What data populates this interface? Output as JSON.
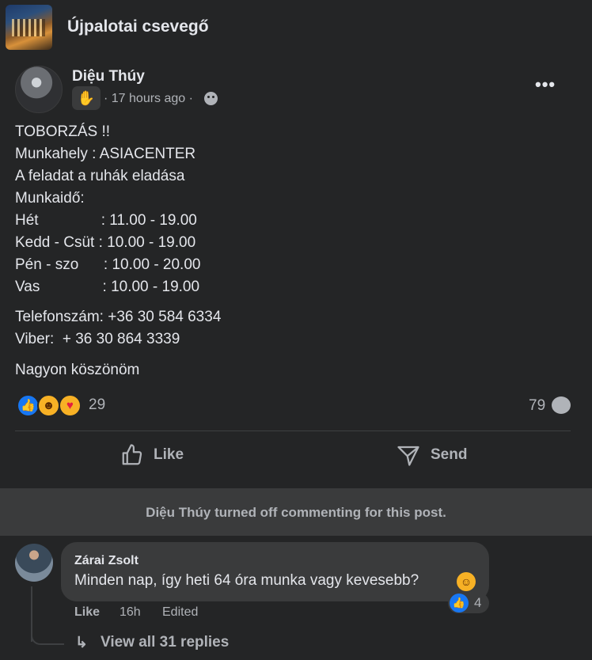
{
  "group": {
    "name": "Újpalotai csevegő",
    "thumb_icon": "group-cover-image"
  },
  "post": {
    "author": "Diệu Thúy",
    "badge_icon": "waving-hand-icon",
    "time": "· 17 hours ago ·",
    "privacy_icon": "group-members-icon",
    "more_label": "•••",
    "lines": [
      "TOBORZÁS !!",
      "Munkahely : ASIACENTER",
      "A feladat a ruhák eladása",
      "Munkaidő:",
      "Hét               : 11.00 - 19.00",
      "Kedd - Csüt : 10.00 - 19.00",
      "Pén - szo      : 10.00 - 20.00",
      "Vas               : 10.00 - 19.00",
      "Telefonszám: +36 30 584 6334",
      "Viber:  + 36 30 864 3339",
      "Nagyon köszönöm"
    ],
    "reaction_count": "29",
    "reaction_icons": [
      "like-icon",
      "haha-icon",
      "care-icon"
    ],
    "comment_count": "79",
    "actions": {
      "like": "Like",
      "send": "Send"
    }
  },
  "notice": "Diệu Thúy turned off commenting for this post.",
  "comment": {
    "author": "Zárai Zsolt",
    "text": "Minden nap, így heti 64 óra munka vagy kevesebb?",
    "emoji_icon": "sweat-smile-emoji",
    "reaction_count": "4",
    "like_label": "Like",
    "time": "16h",
    "edited_label": "Edited",
    "view_replies": "View all 31 replies"
  },
  "colors": {
    "background": "#18191a",
    "card": "#242526",
    "accent": "#1877f2",
    "muted": "#b0b3b8"
  }
}
